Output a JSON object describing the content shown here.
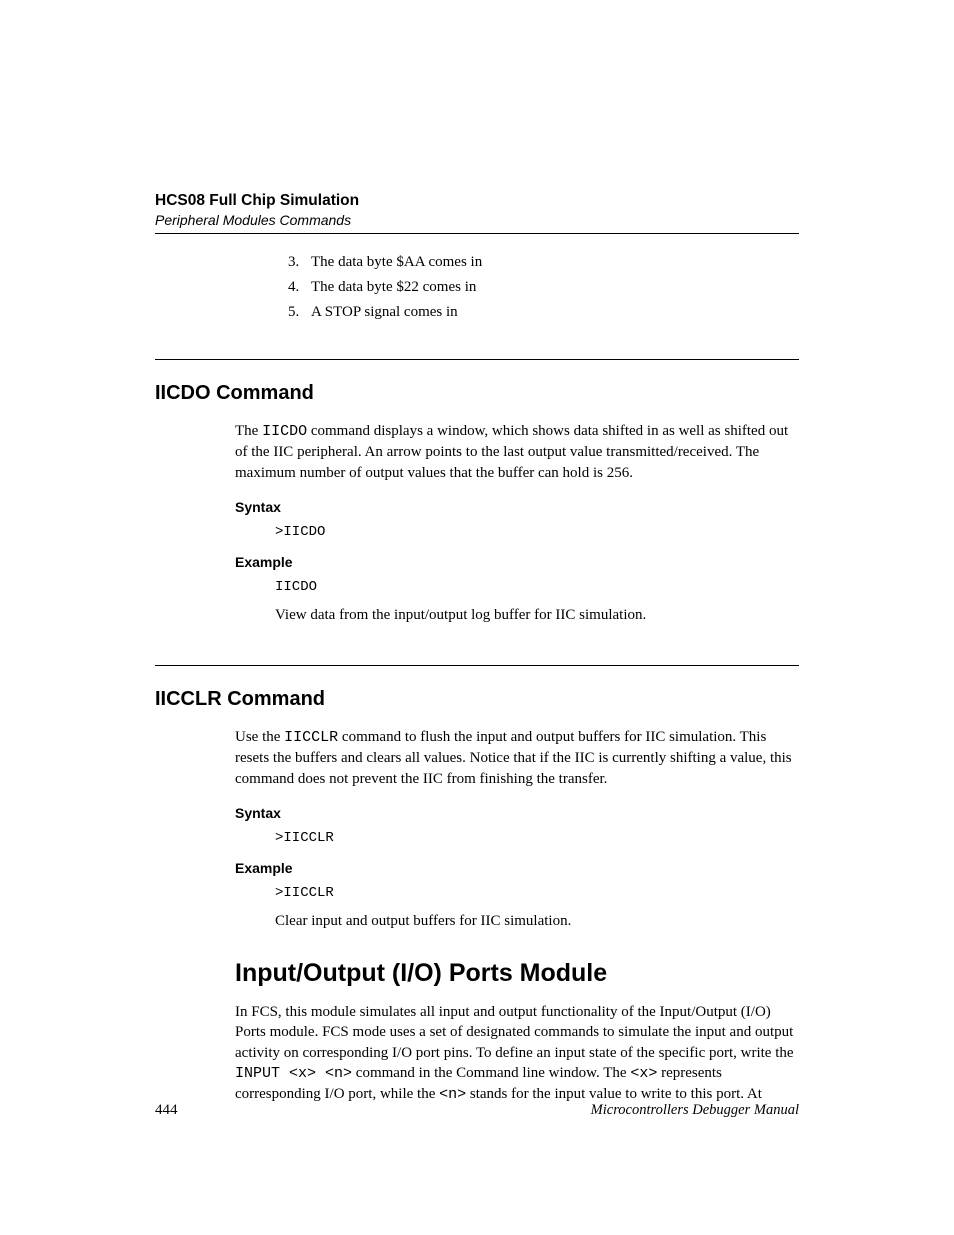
{
  "header": {
    "title": "HCS08 Full Chip Simulation",
    "subtitle": "Peripheral Modules Commands"
  },
  "top_list": {
    "item3": "The data byte $AA comes in",
    "item4": "The data byte $22 comes in",
    "item5": "A STOP signal comes in"
  },
  "iicdo": {
    "heading": "IICDO Command",
    "desc_pre": "The ",
    "desc_mono": "IICDO",
    "desc_post": " command displays a window, which shows data shifted in as well as shifted out of the IIC peripheral. An arrow points to the last output value transmitted/received. The maximum number of output values that the buffer can hold is 256.",
    "syntax_label": "Syntax",
    "syntax_code": ">IICDO",
    "example_label": "Example",
    "example_code": "IICDO",
    "example_text": "View data from the input/output log buffer for IIC simulation."
  },
  "iicclr": {
    "heading": "IICCLR Command",
    "desc_pre": "Use the ",
    "desc_mono": "IICCLR",
    "desc_post": " command to flush the input and output buffers for IIC simulation. This resets the buffers and clears all values. Notice that if the IIC is currently shifting a value, this command does not prevent the IIC from finishing the transfer.",
    "syntax_label": "Syntax",
    "syntax_code": ">IICCLR",
    "example_label": "Example",
    "example_code": ">IICCLR",
    "example_text": "Clear input and output buffers for IIC simulation."
  },
  "io_module": {
    "heading": "Input/Output (I/O) Ports Module",
    "desc_p1": "In FCS, this module simulates all input and output functionality of the Input/Output (I/O) Ports module. FCS mode uses a set of designated commands to simulate the input and output activity on corresponding I/O port pins. To define an input state of the specific port, write the ",
    "desc_mono1": "INPUT <x> <n>",
    "desc_p2": " command in the Command line window. The ",
    "desc_mono2": "<x>",
    "desc_p3": " represents corresponding I/O port, while the ",
    "desc_mono3": "<n>",
    "desc_p4": " stands for the input value to write to this port. At"
  },
  "footer": {
    "page": "444",
    "title": "Microcontrollers Debugger Manual"
  }
}
